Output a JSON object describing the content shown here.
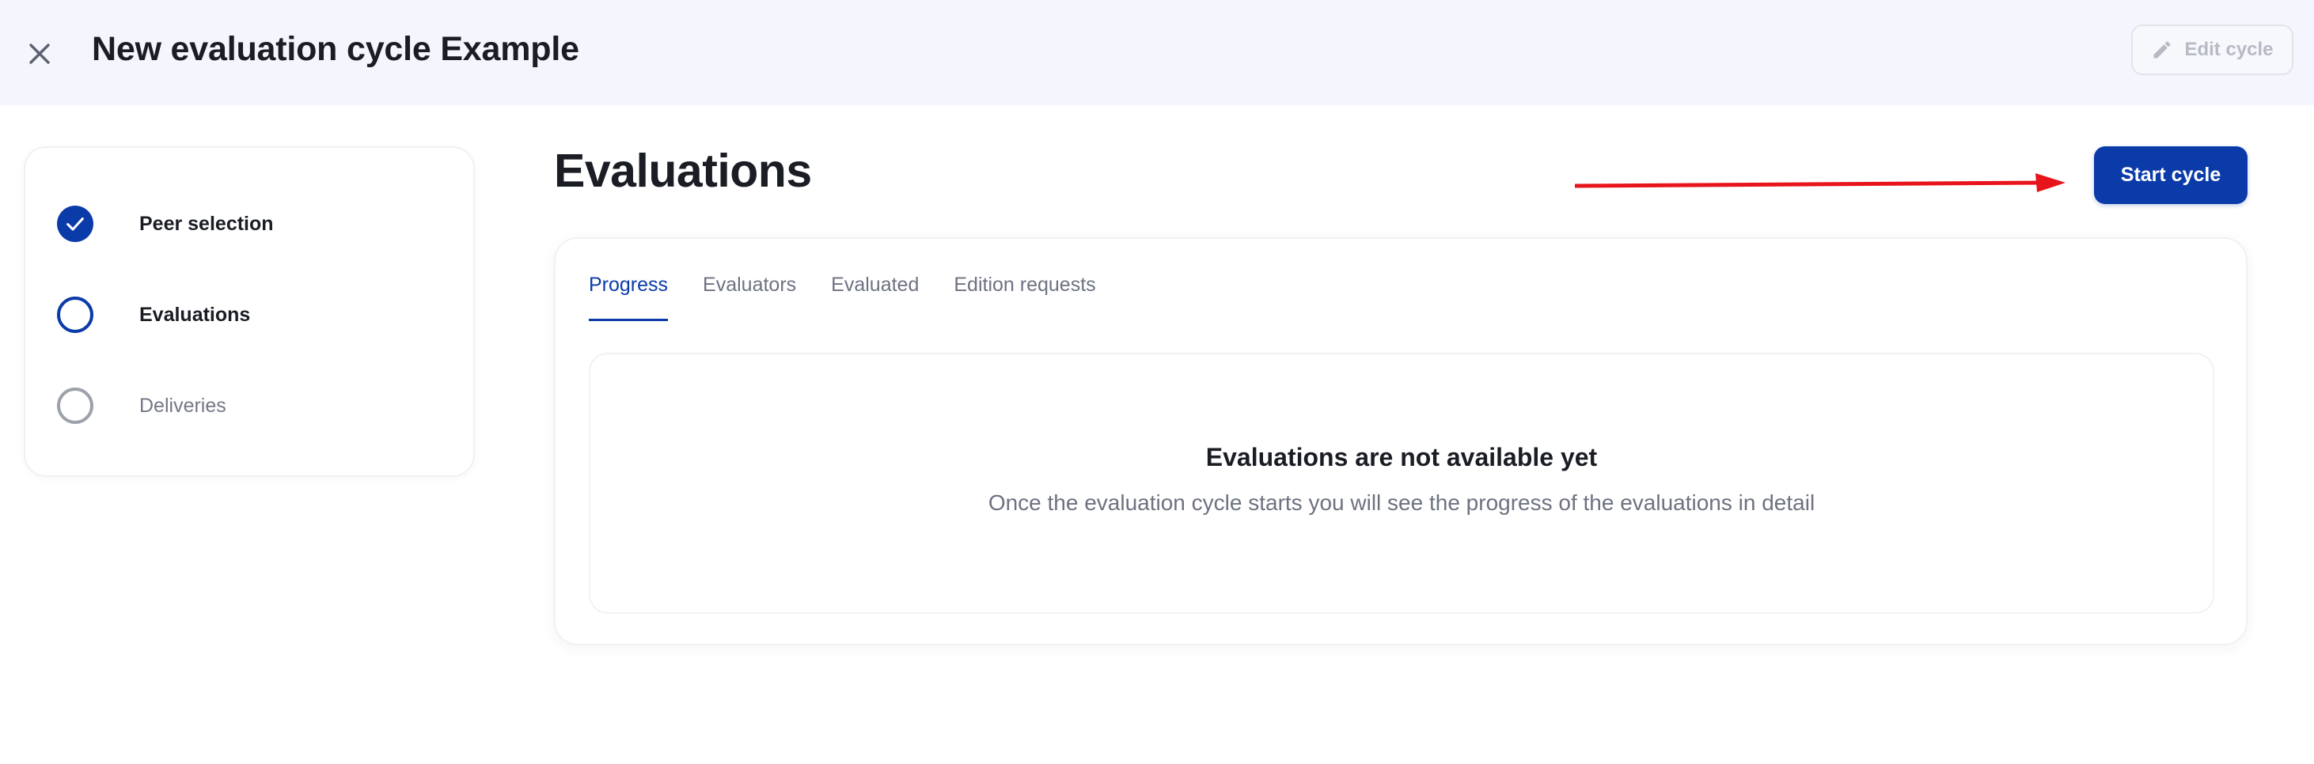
{
  "header": {
    "title": "New evaluation cycle Example",
    "close_icon": "close-icon",
    "edit_label": "Edit cycle",
    "edit_icon": "pencil-icon"
  },
  "steps": [
    {
      "label": "Peer selection",
      "state": "completed",
      "icon": "checkmark-icon"
    },
    {
      "label": "Evaluations",
      "state": "current"
    },
    {
      "label": "Deliveries",
      "state": "pending"
    }
  ],
  "main": {
    "title": "Evaluations",
    "start_label": "Start cycle",
    "tabs": [
      {
        "label": "Progress",
        "active": true
      },
      {
        "label": "Evaluators",
        "active": false
      },
      {
        "label": "Evaluated",
        "active": false
      },
      {
        "label": "Edition requests",
        "active": false
      }
    ],
    "empty": {
      "title": "Evaluations are not available yet",
      "subtitle": "Once the evaluation cycle starts you will see the progress of the evaluations in detail"
    }
  },
  "colors": {
    "primary": "#0b3ba8",
    "header_bg": "#f5f6fd",
    "annotation": "#e8141b",
    "muted_text": "#6d7280"
  }
}
